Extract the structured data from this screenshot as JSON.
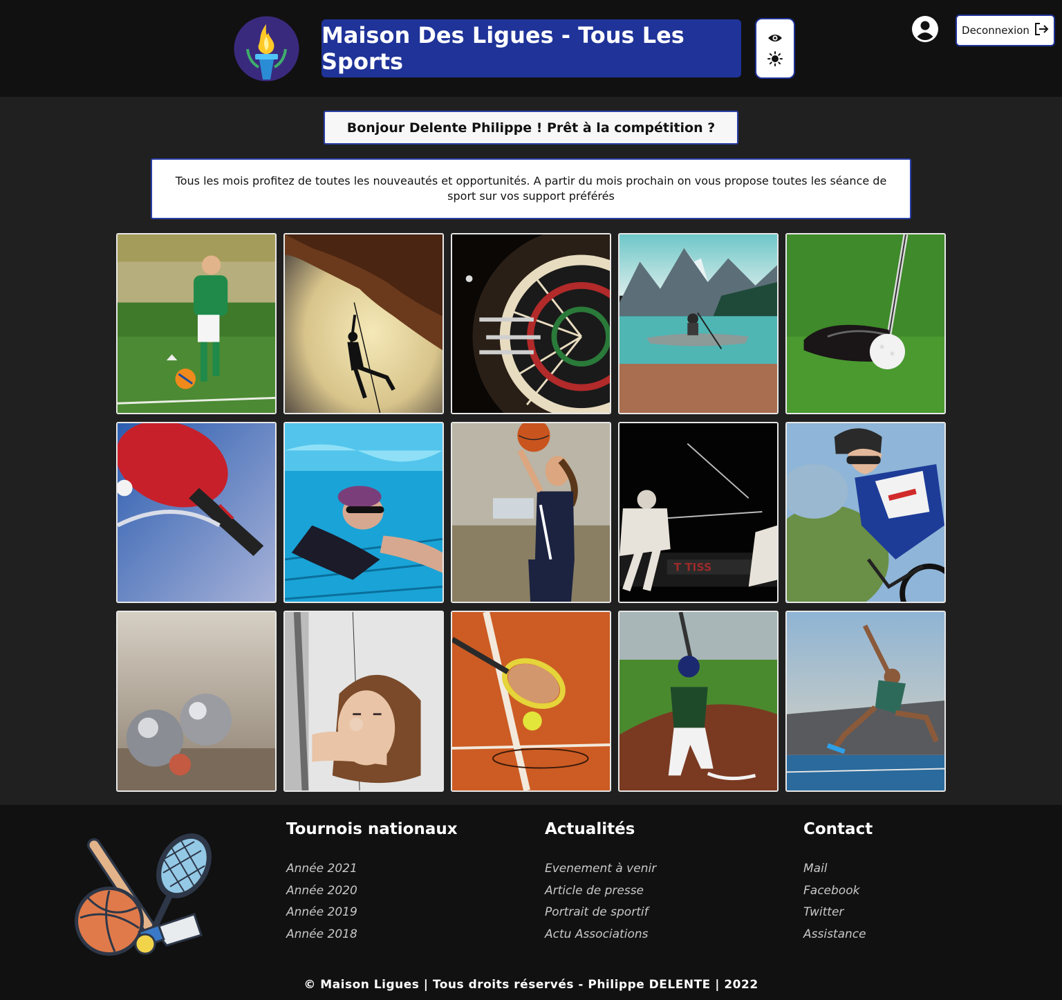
{
  "header": {
    "title": "Maison Des Ligues - Tous Les Sports",
    "logout_label": "Deconnexion",
    "icons": {
      "logo": "torch-logo-icon",
      "visibility": "eye-icon",
      "theme": "sun-icon",
      "account": "user-account-icon",
      "logout": "logout-icon"
    }
  },
  "main": {
    "greeting": "Bonjour Delente Philippe ! Prêt à la compétition ?",
    "info": "Tous les mois profitez de toutes les nouveautés et opportunités. A partir du mois prochain on vous propose toutes les séance de sport sur vos support préférés"
  },
  "gallery": [
    {
      "sport": "football"
    },
    {
      "sport": "escalade"
    },
    {
      "sport": "flechettes"
    },
    {
      "sport": "kayak"
    },
    {
      "sport": "golf"
    },
    {
      "sport": "tennis-de-table"
    },
    {
      "sport": "natation"
    },
    {
      "sport": "basketball"
    },
    {
      "sport": "escrime"
    },
    {
      "sport": "cyclisme"
    },
    {
      "sport": "petanque"
    },
    {
      "sport": "tir-a-l-arc"
    },
    {
      "sport": "tennis"
    },
    {
      "sport": "baseball"
    },
    {
      "sport": "athletisme"
    }
  ],
  "footer": {
    "columns": [
      {
        "title": "Tournois nationaux",
        "links": [
          "Année 2021",
          "Année 2020",
          "Année 2019",
          "Année 2018"
        ]
      },
      {
        "title": "Actualités",
        "links": [
          "Evenement à venir",
          "Article de presse",
          "Portrait de sportif",
          "Actu Associations"
        ]
      },
      {
        "title": "Contact",
        "links": [
          "Mail",
          "Facebook",
          "Twitter",
          "Assistance"
        ]
      }
    ],
    "copyright": "© Maison Ligues | Tous droits réservés - Philippe DELENTE | 2022"
  },
  "colors": {
    "header_bg": "#111111",
    "body_bg": "#202020",
    "accent": "#1f3399"
  }
}
